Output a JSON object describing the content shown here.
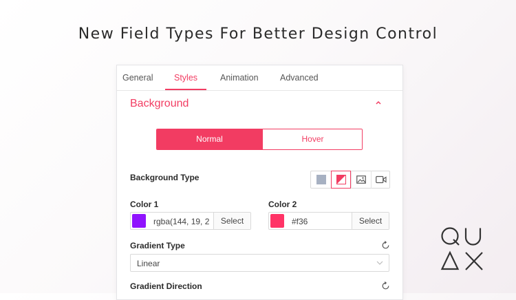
{
  "headline": "New Field Types For Better Design Control",
  "tabs": [
    {
      "label": "General"
    },
    {
      "label": "Styles",
      "active": true
    },
    {
      "label": "Animation"
    },
    {
      "label": "Advanced"
    }
  ],
  "section": {
    "title": "Background",
    "collapse_icon": "chevron-up-icon"
  },
  "state_toggle": {
    "normal": "Normal",
    "hover": "Hover",
    "selected": "Normal"
  },
  "background_type": {
    "label": "Background Type",
    "options": [
      "color-icon",
      "gradient-icon",
      "image-icon",
      "video-icon"
    ],
    "selected": "gradient-icon"
  },
  "color1": {
    "label": "Color 1",
    "value": "rgba(144, 19, 2",
    "swatch": "#9013fe",
    "select_label": "Select"
  },
  "color2": {
    "label": "Color 2",
    "value": "#f36",
    "swatch": "#ff3366",
    "select_label": "Select"
  },
  "gradient_type": {
    "label": "Gradient Type",
    "value": "Linear"
  },
  "gradient_direction": {
    "label": "Gradient Direction"
  },
  "colors": {
    "accent": "#f23c62",
    "text": "#2b2b2b",
    "border": "#d9d9d9"
  },
  "logo": {
    "text": "QUAX"
  }
}
